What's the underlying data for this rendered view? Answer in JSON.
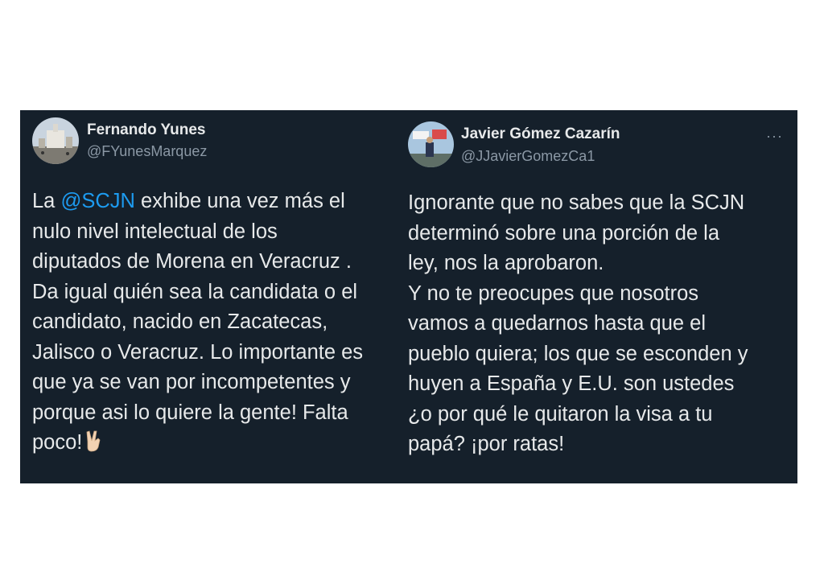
{
  "tweets": [
    {
      "author_name": "Fernando Yunes",
      "author_handle": "@FYunesMarquez",
      "lines": [
        {
          "pre": "La ",
          "mention": "@SCJN",
          "post": " exhibe una vez más el"
        },
        {
          "text": "nulo nivel intelectual de los"
        },
        {
          "text": "diputados de Morena en Veracruz ."
        },
        {
          "text": "Da igual quién sea la candidata o el"
        },
        {
          "text": "candidato, nacido en Zacatecas,"
        },
        {
          "text": "Jalisco o Veracruz. Lo importante es"
        },
        {
          "text": "que ya se van por incompetentes y"
        },
        {
          "text": "porque asi lo quiere la gente! Falta"
        },
        {
          "text": "poco!"
        }
      ],
      "emoji_icon": "victory-hand-icon"
    },
    {
      "author_name": "Javier Gómez Cazarín",
      "author_handle": "@JJavierGomezCa1",
      "more_label": "···",
      "lines": [
        {
          "text": "Ignorante que no sabes que la SCJN"
        },
        {
          "text": "determinó sobre una porción de la"
        },
        {
          "text": "ley, nos la aprobaron."
        },
        {
          "text": "Y no te preocupes que nosotros"
        },
        {
          "text": "vamos a quedarnos hasta que el"
        },
        {
          "text": "pueblo quiera; los que se esconden y"
        },
        {
          "text": "huyen a España y E.U. son ustedes"
        },
        {
          "text": "¿o por qué le quitaron la visa a tu"
        },
        {
          "text": "papá? ¡por ratas!"
        }
      ]
    }
  ]
}
